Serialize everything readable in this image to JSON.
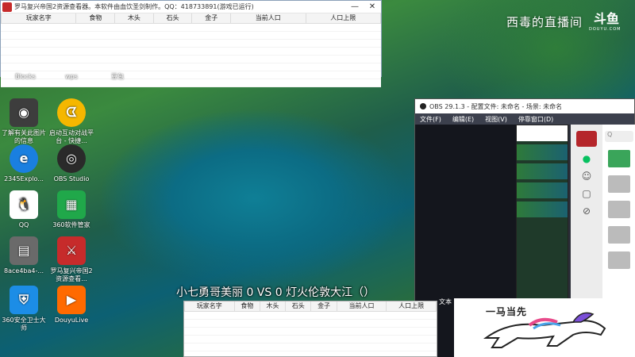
{
  "tool_window": {
    "title": "罗马复兴帝国2资源查看器。本软件由血饮圣剑制作。QQ：418733891(游戏已运行)",
    "minimize": "—",
    "close": "✕",
    "columns": [
      "玩家名字",
      "食物",
      "木头",
      "石头",
      "金子",
      "当前人口",
      "人口上限"
    ]
  },
  "desktop_icons": [
    {
      "label": "Blocks",
      "icon": "blocks-icon",
      "color": "#3a7bd5"
    },
    {
      "label": "wps",
      "icon": "wps-icon",
      "color": "#d8322c"
    },
    {
      "label": "豆包",
      "icon": "doubao-icon",
      "color": "#4b79ff"
    },
    {
      "label": "了解有关此图片的信息",
      "icon": "info-picture-icon",
      "color": "#3d3d3d"
    },
    {
      "label": "启动互动对战平台 - 快捷...",
      "icon": "pacman-icon",
      "color": "#f5b700"
    },
    {
      "label": "2345Explo...",
      "icon": "browser-e-icon",
      "color": "#1a7fe0"
    },
    {
      "label": "OBS Studio",
      "icon": "obs-icon",
      "color": "#2a2a2a"
    },
    {
      "label": "QQ",
      "icon": "qq-icon",
      "color": "#ffffff"
    },
    {
      "label": "360软件管家",
      "icon": "360-manager-icon",
      "color": "#20a84a"
    },
    {
      "label": "8ace4ba4-...",
      "icon": "file-icon",
      "color": "#6a6a6a"
    },
    {
      "label": "罗马复兴帝国2资源查看...",
      "icon": "rome-viewer-icon",
      "color": "#c62b2b"
    },
    {
      "label": "360安全卫士大师",
      "icon": "360-security-icon",
      "color": "#1c8de6"
    },
    {
      "label": "DouyuLive",
      "icon": "douyu-live-icon",
      "color": "#ff6a00"
    }
  ],
  "brand": {
    "name": "西毒的直播间",
    "logo": "斗鱼",
    "sub": "DOUYU.COM"
  },
  "obs": {
    "title": "OBS 29.1.3 - 配置文件: 未命名 - 场景: 未命名",
    "menu": [
      "文件(F)",
      "编辑(E)",
      "视图(V)",
      "停靠窗口(D)"
    ],
    "side_label": "文本",
    "search_hint": "Q"
  },
  "caption": "小七勇哥美丽 0 VS 0 灯火伦敦大江（）",
  "sticker": {
    "tag": "一马当先"
  }
}
